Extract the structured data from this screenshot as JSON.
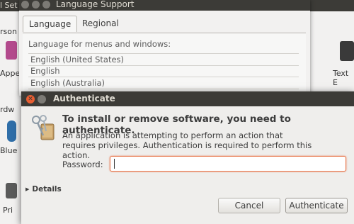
{
  "settings": {
    "title_fragment": "l Set",
    "left_labels": [
      "rson",
      "Appe",
      "rdw",
      "Blue",
      "Pri"
    ],
    "right_label": "Text E"
  },
  "language_support": {
    "title": "Language Support",
    "tabs": [
      "Language",
      "Regional Formats"
    ],
    "active_tab": "Language",
    "hint": "Language for menus and windows:",
    "languages": [
      "English (United States)",
      "English",
      "English (Australia)"
    ]
  },
  "authenticate": {
    "title": "Authenticate",
    "close_glyph": "✕",
    "heading": "To install or remove software, you need to authenticate.",
    "description": "An application is attempting to perform an action that requires privileges. Authentication is required to perform this action.",
    "password_label": "Password:",
    "password_value": "",
    "details_label": "Details",
    "details_arrow": "▶",
    "cancel_label": "Cancel",
    "authenticate_label": "Authenticate"
  },
  "colors": {
    "titlebar": "#3c3b37",
    "close": "#e95e32",
    "focus_border": "#e8774c"
  }
}
